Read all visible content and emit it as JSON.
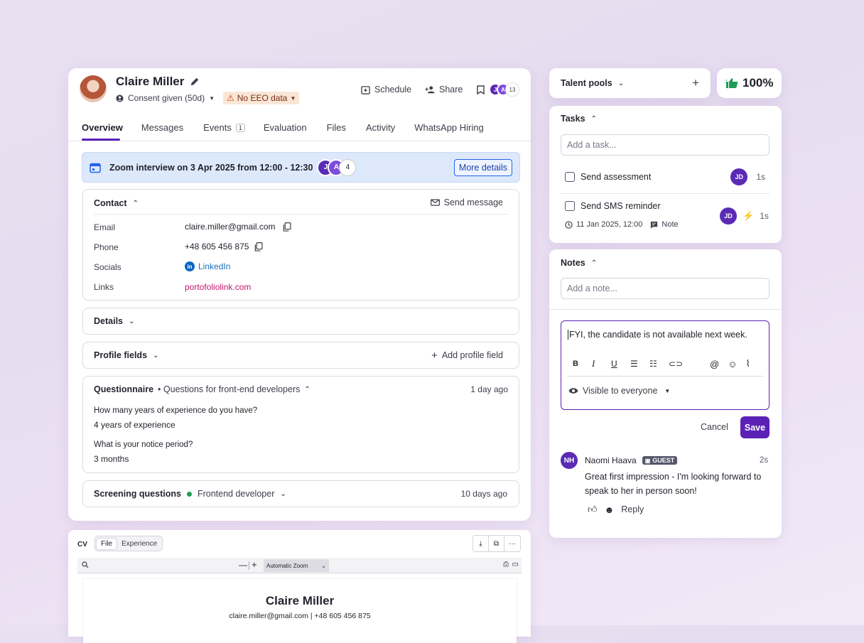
{
  "candidate": {
    "name": "Claire Miller",
    "consent": "Consent given (50d)",
    "eeo": "No EEO data",
    "eeo_color": "#f8e6d6",
    "actions": {
      "schedule": "Schedule",
      "share": "Share",
      "watchers_count": "13"
    },
    "watcher_initials": [
      "J",
      "A"
    ]
  },
  "tabs": [
    {
      "label": "Overview",
      "active": true
    },
    {
      "label": "Messages"
    },
    {
      "label": "Events",
      "badge": "1"
    },
    {
      "label": "Evaluation"
    },
    {
      "label": "Files"
    },
    {
      "label": "Activity"
    },
    {
      "label": "WhatsApp Hiring"
    }
  ],
  "banner": {
    "text": "Zoom interview on 3 Apr 2025 from 12:00 - 12:30",
    "attendees": [
      "J",
      "A"
    ],
    "more_count": "4",
    "button": "More details"
  },
  "contact": {
    "title": "Contact",
    "send_message": "Send message",
    "rows": [
      {
        "label": "Email",
        "value": "claire.miller@gmail.com"
      },
      {
        "label": "Phone",
        "value": "+48 605 456 875"
      },
      {
        "label": "Socials",
        "value": "LinkedIn"
      },
      {
        "label": "Links",
        "value": "portofoliolink.com"
      }
    ]
  },
  "details": {
    "title": "Details"
  },
  "profile_fields": {
    "title": "Profile fields",
    "add": "Add profile field"
  },
  "questionnaire": {
    "title": "Questionnaire",
    "subtitle": "• Questions for front-end developers",
    "time": "1 day ago",
    "items": [
      {
        "q": "How many years of experience do you have?",
        "a": "4 years of experience"
      },
      {
        "q": "What is your notice period?",
        "a": "3 months"
      }
    ]
  },
  "screening": {
    "title": "Screening questions",
    "tag": "Frontend developer",
    "time": "10 days ago"
  },
  "cv": {
    "label": "CV",
    "seg": [
      "File",
      "Experience"
    ],
    "zoom": "Automatic Zoom",
    "doc_name": "Claire Miller",
    "doc_contact": "claire.miller@gmail.com | +48 605 456 875"
  },
  "talent_pools": {
    "title": "Talent pools"
  },
  "score": {
    "value": "100%"
  },
  "tasks": {
    "title": "Tasks",
    "placeholder": "Add a task...",
    "items": [
      {
        "label": "Send assessment",
        "assignee": "JD",
        "time": "1s"
      },
      {
        "label": "Send SMS reminder",
        "assignee": "JD",
        "time": "1s",
        "due": "11 Jan 2025, 12:00",
        "note": "Note"
      }
    ]
  },
  "notes": {
    "title": "Notes",
    "placeholder": "Add a note...",
    "draft": "FYI, the candidate is not available next week.",
    "visibility": "Visible to everyone",
    "cancel": "Cancel",
    "save": "Save",
    "comment": {
      "initials": "NH",
      "author": "Naomi Haava",
      "badge": "GUEST",
      "time": "2s",
      "text": "Great first impression - I'm looking forward to speak to her in person soon!",
      "reply": "Reply"
    }
  },
  "colors": {
    "accent": "#5b21b6",
    "link": "#1d6fb8",
    "pink_link": "#c2186b",
    "banner_bg": "#dde9fb",
    "green": "#1f9d55"
  }
}
